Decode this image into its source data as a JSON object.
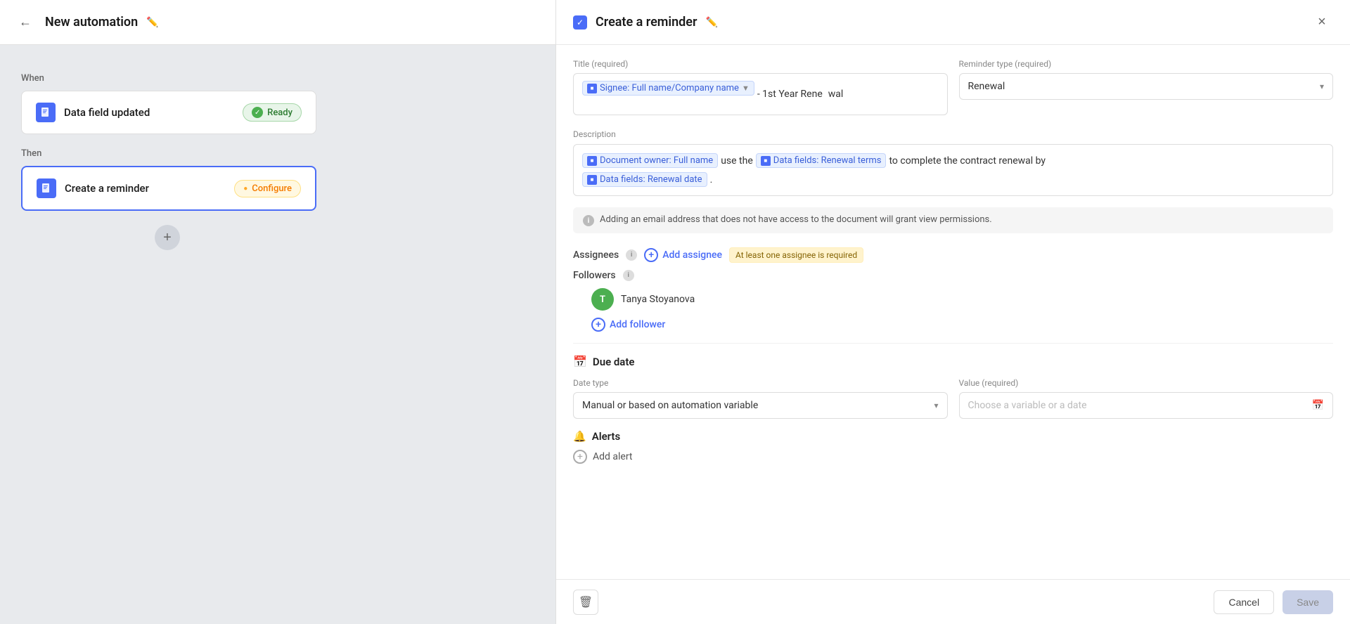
{
  "leftPanel": {
    "title": "New automation",
    "when_label": "When",
    "then_label": "Then",
    "trigger": {
      "name": "Data field updated",
      "status": "Ready"
    },
    "action": {
      "name": "Create a reminder",
      "status": "Configure"
    }
  },
  "rightPanel": {
    "title": "Create a reminder",
    "close_label": "×",
    "titleField": {
      "label": "Title (required)",
      "chip1_doc": "■",
      "chip1_text": "Signee: Full name/Company name",
      "chip1_filter": "▼",
      "separator": "- 1st Year Rene",
      "line2": "wal"
    },
    "reminderType": {
      "label": "Reminder type (required)",
      "value": "Renewal",
      "arrow": "▾"
    },
    "description": {
      "label": "Description",
      "line1_chip1": "Document owner: Full name",
      "line1_text1": "use the",
      "line1_chip2": "Data fields: Renewal terms",
      "line1_text2": "to complete the contract renewal by",
      "line2_chip": "Data fields: Renewal date",
      "line2_end": "."
    },
    "notice": "Adding an email address that does not have access to the document will grant view permissions.",
    "assignees": {
      "label": "Assignees",
      "add_label": "Add assignee",
      "required_badge": "At least one assignee is required"
    },
    "followers": {
      "label": "Followers",
      "user": "Tanya Stoyanova",
      "user_initial": "T",
      "add_label": "Add follower"
    },
    "dueDate": {
      "label": "Due date",
      "dateTypeLabel": "Date type",
      "dateTypeValue": "Manual or based on automation variable",
      "dateTypeArrow": "▾",
      "valueLabel": "Value (required)",
      "valuePlaceholder": "Choose a variable or a date",
      "calendar_icon": "📅"
    },
    "alerts": {
      "label": "Alerts",
      "add_label": "Add alert"
    },
    "footer": {
      "cancel_label": "Cancel",
      "save_label": "Save"
    }
  }
}
